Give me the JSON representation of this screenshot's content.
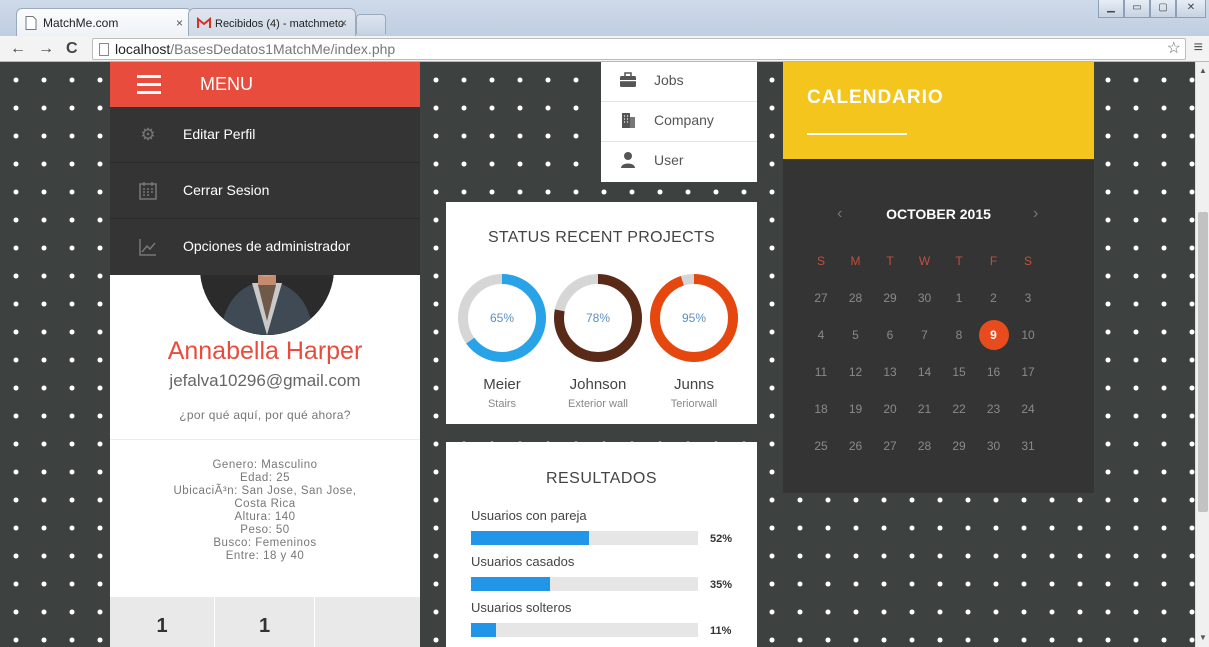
{
  "browser": {
    "tabs": [
      {
        "title": "MatchMe.com",
        "close": "×"
      },
      {
        "title": "Recibidos (4) - matchmeto",
        "close": "×"
      }
    ],
    "url_host": "localhost",
    "url_path": "/BasesDedatos1MatchMe/index.php",
    "nav": {
      "back": "←",
      "forward": "→",
      "reload": "C",
      "star": "☆",
      "menu": "≡"
    }
  },
  "menu": {
    "title": "MENU",
    "items": [
      {
        "label": "Editar Perfil",
        "icon": "gear-icon"
      },
      {
        "label": "Cerrar Sesion",
        "icon": "calendar-icon"
      },
      {
        "label": "Opciones de administrador",
        "icon": "chart-icon"
      }
    ]
  },
  "profile": {
    "name": "Annabella Harper",
    "email": "jefalva10296@gmail.com",
    "tagline": "¿por qué aquí, por qué ahora?",
    "details": [
      "Genero: Masculino",
      "Edad: 25",
      "UbicaciÃ³n: San Jose, San Jose,",
      "Costa Rica",
      "Altura: 140",
      "Peso: 50",
      "Busco: Femeninos",
      "Entre: 18 y 40"
    ],
    "stats": [
      "1",
      "1"
    ]
  },
  "dropdown": {
    "items": [
      {
        "label": "Jobs",
        "icon": "briefcase-icon"
      },
      {
        "label": "Company",
        "icon": "building-icon"
      },
      {
        "label": "User",
        "icon": "user-icon"
      }
    ]
  },
  "projects": {
    "title": "STATUS RECENT PROJECTS",
    "items": [
      {
        "pct_label": "65%",
        "value": 0.65,
        "name": "Meier",
        "sub": "Stairs",
        "color": "#29a3e8"
      },
      {
        "pct_label": "78%",
        "value": 0.78,
        "name": "Johnson",
        "sub": "Exterior wall",
        "color": "#5a2a18"
      },
      {
        "pct_label": "95%",
        "value": 0.95,
        "name": "Junns",
        "sub": "Teriorwall",
        "color": "#e5470f"
      }
    ]
  },
  "results": {
    "title": "RESULTADOS",
    "items": [
      {
        "label": "Usuarios con pareja",
        "pct_label": "52%",
        "value": 0.52
      },
      {
        "label": "Usuarios casados",
        "pct_label": "35%",
        "value": 0.35
      },
      {
        "label": "Usuarios solteros",
        "pct_label": "11%",
        "value": 0.11
      }
    ]
  },
  "calendar": {
    "title": "CALENDARIO",
    "prev": "‹",
    "next": "›",
    "month": "OCTOBER 2015",
    "weekdays": [
      "S",
      "M",
      "T",
      "W",
      "T",
      "F",
      "S"
    ],
    "weeks": [
      [
        "27",
        "28",
        "29",
        "30",
        "1",
        "2",
        "3"
      ],
      [
        "4",
        "5",
        "6",
        "7",
        "8",
        "9",
        "10"
      ],
      [
        "11",
        "12",
        "13",
        "14",
        "15",
        "16",
        "17"
      ],
      [
        "18",
        "19",
        "20",
        "21",
        "22",
        "23",
        "24"
      ],
      [
        "25",
        "26",
        "27",
        "28",
        "29",
        "30",
        "31"
      ]
    ],
    "today": "9"
  },
  "colors": {
    "accent_red": "#e84c3d",
    "calendar_yellow": "#f3c51d",
    "bar_blue": "#2196e8",
    "dark_panel": "#333433"
  }
}
